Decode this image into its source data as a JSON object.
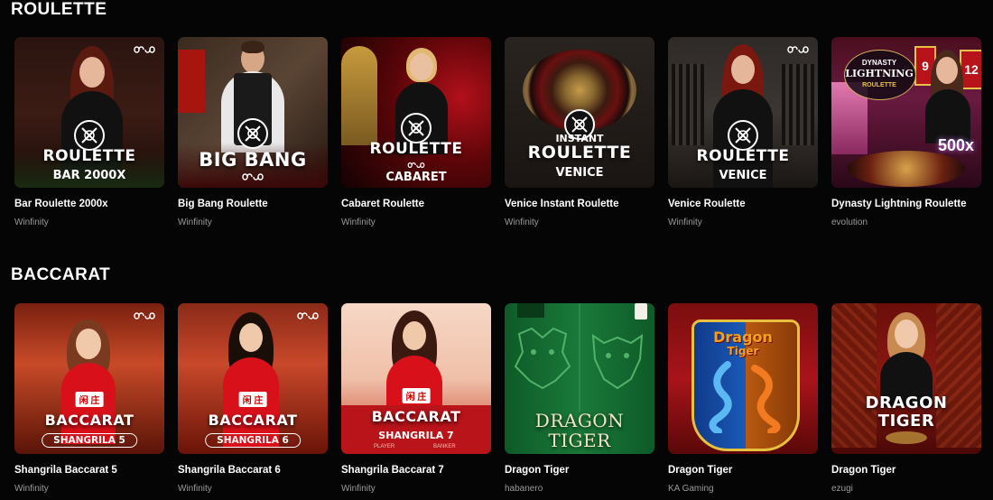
{
  "sections": [
    {
      "title": "ROULETTE",
      "games": [
        {
          "name": "Bar Roulette 2000x",
          "provider": "Winfinity",
          "tile_title": "ROULETTE",
          "tile_sub": "BAR 2000X"
        },
        {
          "name": "Big Bang Roulette",
          "provider": "Winfinity",
          "tile_title": "BIG BANG",
          "tile_sub": ""
        },
        {
          "name": "Cabaret Roulette",
          "provider": "Winfinity",
          "tile_title": "ROULETTE",
          "tile_sub": "CABARET"
        },
        {
          "name": "Venice Instant Roulette",
          "provider": "Winfinity",
          "tile_pre": "INSTANT",
          "tile_title": "ROULETTE",
          "tile_sub": "VENICE"
        },
        {
          "name": "Venice Roulette",
          "provider": "Winfinity",
          "tile_title": "ROULETTE",
          "tile_sub": "VENICE"
        },
        {
          "name": "Dynasty Lightning Roulette",
          "provider": "evolution",
          "tile_pre": "DYNASTY",
          "tile_title": "LIGHTNING",
          "tile_sub": "ROULETTE",
          "tile_badge": "500x",
          "tile_nums": [
            "9",
            "12"
          ]
        }
      ]
    },
    {
      "title": "BACCARAT",
      "games": [
        {
          "name": "Shangrila Baccarat 5",
          "provider": "Winfinity",
          "tile_title": "BACCARAT",
          "tile_sub": "SHANGRILA 5",
          "tile_chip": "闲 庄"
        },
        {
          "name": "Shangrila Baccarat 6",
          "provider": "Winfinity",
          "tile_title": "BACCARAT",
          "tile_sub": "SHANGRILA 6",
          "tile_chip": "闲 庄"
        },
        {
          "name": "Shangrila Baccarat 7",
          "provider": "Winfinity",
          "tile_title": "BACCARAT",
          "tile_sub": "SHANGRILA 7",
          "tile_chip": "闲 庄",
          "tile_left": "PLAYER",
          "tile_right": "BANKER"
        },
        {
          "name": "Dragon Tiger",
          "provider": "habanero",
          "tile_title": "DRAGON",
          "tile_sub": "TIGER"
        },
        {
          "name": "Dragon Tiger",
          "provider": "KA Gaming",
          "tile_title": "Dragon",
          "tile_sub": "Tiger"
        },
        {
          "name": "Dragon Tiger",
          "provider": "ezugi",
          "tile_title": "DRAGON",
          "tile_sub": "TIGER"
        }
      ]
    }
  ]
}
